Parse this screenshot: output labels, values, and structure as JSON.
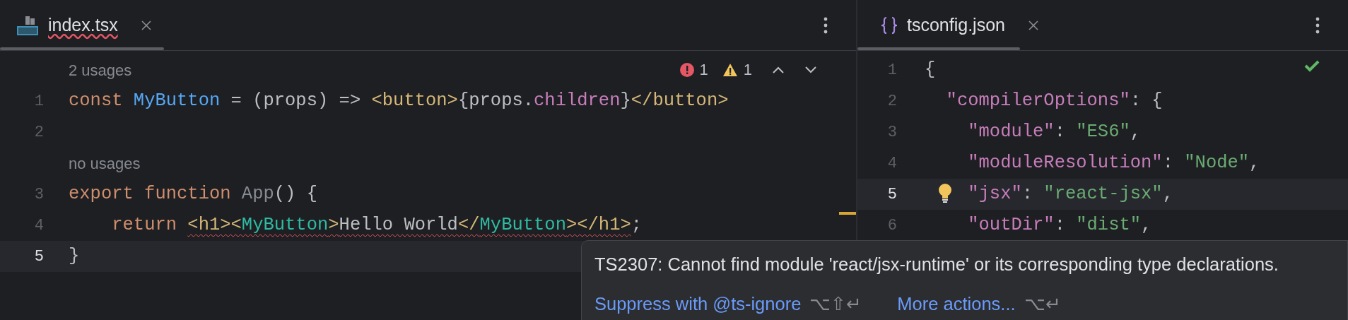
{
  "editors": [
    {
      "tab": {
        "label": "index.tsx",
        "has_error": true
      },
      "inspections": {
        "kind": "problems",
        "errors": "1",
        "warnings": "1"
      },
      "lines": [
        {
          "kind": "hint",
          "text": "2 usages"
        },
        {
          "kind": "code",
          "number": "1",
          "current": false,
          "tokens": [
            {
              "kind": "keyword",
              "text": "const "
            },
            {
              "kind": "function",
              "text": "MyButton"
            },
            {
              "kind": "plain",
              "text": " = (props) => "
            },
            {
              "kind": "tag",
              "text": "<button>"
            },
            {
              "kind": "plain",
              "text": "{props."
            },
            {
              "kind": "property",
              "text": "children"
            },
            {
              "kind": "plain",
              "text": "}"
            },
            {
              "kind": "tag",
              "text": "</button>"
            }
          ]
        },
        {
          "kind": "code",
          "number": "2",
          "current": false
        },
        {
          "kind": "hint",
          "text": "no usages"
        },
        {
          "kind": "code",
          "number": "3",
          "current": false,
          "tokens": [
            {
              "kind": "keyword",
              "text": "export function "
            },
            {
              "kind": "unused",
              "text": "App"
            },
            {
              "kind": "plain",
              "text": "() {"
            }
          ]
        },
        {
          "kind": "code",
          "number": "4",
          "current": false,
          "tokens": [
            {
              "kind": "keyword",
              "text": "    return "
            },
            {
              "kind": "tag",
              "text": "<h1><",
              "error": true
            },
            {
              "kind": "component",
              "text": "MyButton",
              "error": true
            },
            {
              "kind": "tag",
              "text": ">",
              "error": true
            },
            {
              "kind": "plain",
              "text": "Hello World",
              "error": true
            },
            {
              "kind": "tag",
              "text": "</",
              "error": true
            },
            {
              "kind": "component",
              "text": "MyButton",
              "error": true
            },
            {
              "kind": "tag",
              "text": "></h1>",
              "error": true
            },
            {
              "kind": "plain",
              "text": ";"
            }
          ]
        },
        {
          "kind": "code",
          "number": "5",
          "current": true,
          "tokens": [
            {
              "kind": "plain",
              "text": "}"
            }
          ]
        }
      ]
    },
    {
      "tab": {
        "label": "tsconfig.json",
        "has_error": false
      },
      "inspections": {
        "kind": "ok"
      },
      "lines": [
        {
          "kind": "code",
          "number": "1",
          "current": false,
          "tokens": [
            {
              "kind": "plain",
              "text": "{"
            }
          ]
        },
        {
          "kind": "code",
          "number": "2",
          "current": false,
          "tokens": [
            {
              "kind": "key",
              "text": "  \"compilerOptions\""
            },
            {
              "kind": "plain",
              "text": ": {"
            }
          ]
        },
        {
          "kind": "code",
          "number": "3",
          "current": false,
          "tokens": [
            {
              "kind": "key",
              "text": "    \"module\""
            },
            {
              "kind": "plain",
              "text": ": "
            },
            {
              "kind": "string",
              "text": "\"ES6\""
            },
            {
              "kind": "plain",
              "text": ","
            }
          ]
        },
        {
          "kind": "code",
          "number": "4",
          "current": false,
          "tokens": [
            {
              "kind": "key",
              "text": "    \"moduleResolution\""
            },
            {
              "kind": "plain",
              "text": ": "
            },
            {
              "kind": "string",
              "text": "\"Node\""
            },
            {
              "kind": "plain",
              "text": ","
            }
          ]
        },
        {
          "kind": "code",
          "number": "5",
          "current": true,
          "bulb": true,
          "tokens": [
            {
              "kind": "key",
              "text": "    \"jsx\""
            },
            {
              "kind": "plain",
              "text": ": "
            },
            {
              "kind": "string",
              "text": "\"react-jsx\""
            },
            {
              "kind": "plain",
              "text": ","
            }
          ]
        },
        {
          "kind": "code",
          "number": "6",
          "current": false,
          "tokens": [
            {
              "kind": "key",
              "text": "    \"outDir\""
            },
            {
              "kind": "plain",
              "text": ": "
            },
            {
              "kind": "string",
              "text": "\"dist\""
            },
            {
              "kind": "plain",
              "text": ","
            }
          ]
        }
      ]
    }
  ],
  "tooltip": {
    "message": "TS2307: Cannot find module 'react/jsx-runtime' or its corresponding type declarations.",
    "actions": [
      {
        "label": "Suppress with @ts-ignore",
        "shortcut": "⌥⇧↵"
      },
      {
        "label": "More actions...",
        "shortcut": "⌥↵"
      }
    ]
  }
}
